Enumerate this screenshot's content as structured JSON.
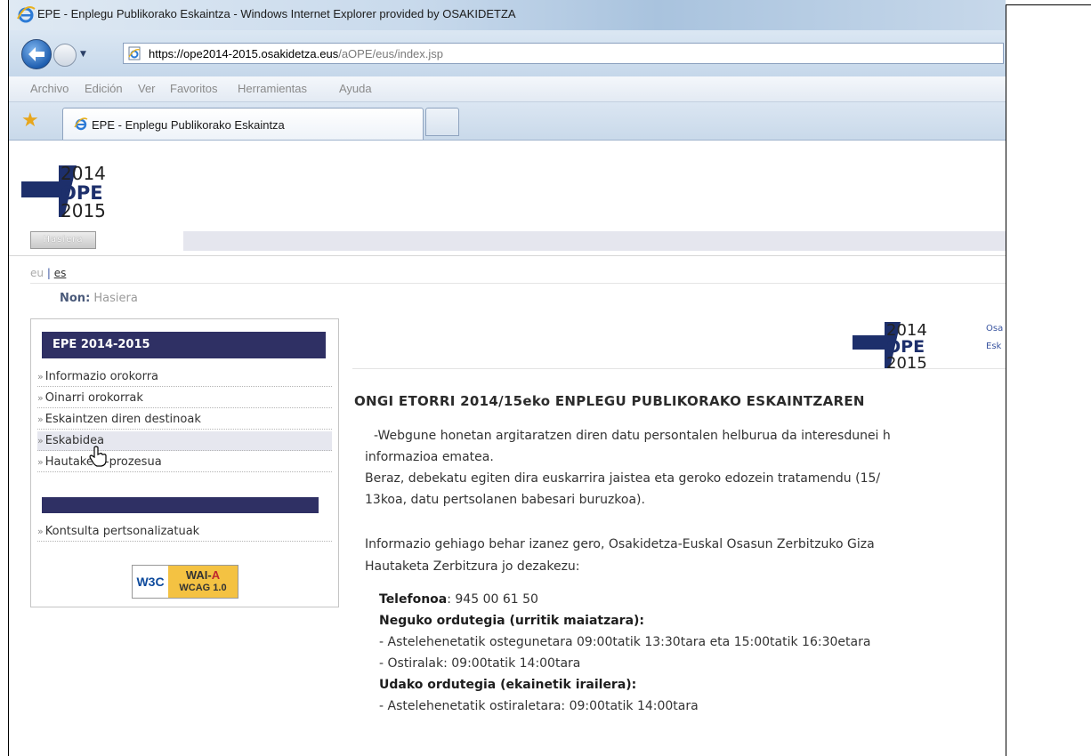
{
  "window": {
    "title": "EPE - Enplegu Publikorako Eskaintza - Windows Internet Explorer provided by OSAKIDETZA"
  },
  "address_bar": {
    "url_host": "https://ope2014-2015.osakidetza.eus",
    "url_path": "/aOPE/eus/index.jsp"
  },
  "menubar": {
    "items": [
      "Archivo",
      "Edición",
      "Ver",
      "Favoritos",
      "Herramientas",
      "Ayuda"
    ]
  },
  "tabs": [
    {
      "label": "EPE - Enplegu Publikorako Eskaintza"
    }
  ],
  "logo": {
    "top": "2014",
    "mid": "OPE",
    "bottom": "2015"
  },
  "nav": {
    "home_label": "Hasiera"
  },
  "lang": {
    "eu": "eu",
    "sep": "|",
    "es": "es"
  },
  "breadcrumb": {
    "label": "Non:",
    "current": "Hasiera"
  },
  "sidebar": {
    "header": "EPE 2014-2015",
    "items": [
      {
        "label": "Informazio orokorra"
      },
      {
        "label": "Oinarri orokorrak"
      },
      {
        "label": "Eskaintzen diren destinoak"
      },
      {
        "label": "Eskabidea"
      },
      {
        "label": "Hautaketa-prozesua"
      }
    ],
    "items2": [
      {
        "label": "Kontsulta pertsonalizatuak"
      }
    ],
    "badge": {
      "w3c": "W3C",
      "wai": "WAI-",
      "wai_level": "A",
      "wcag": "WCAG 1.0"
    }
  },
  "main": {
    "side_text_1": "Osa",
    "side_text_2": "Esk",
    "title": "ONGI ETORRI 2014/15eko ENPLEGU PUBLIKORAKO ESKAINTZAREN",
    "para1_line1": "-Webgune honetan argitaratzen diren datu persontalen helburua da interesdunei h",
    "para1_line2": "informazioa ematea.",
    "para1_line3": "Beraz, debekatu egiten dira euskarrira jaistea eta geroko edozein tratamendu (15/",
    "para1_line4": "13koa, datu pertsolanen babesari buruzkoa).",
    "para2_line1": "Informazio gehiago behar izanez gero, Osakidetza-Euskal Osasun Zerbitzuko Giza",
    "para2_line2": "Hautaketa Zerbitzura jo dezakezu:",
    "phone_label": "Telefonoa",
    "phone_value": ": 945 00 61 50",
    "winter_title": "Neguko ordutegia (urritik maiatzara):",
    "winter_line1": "- Astelehenetatik ostegunetara 09:00tatik 13:30tara eta 15:00tatik 16:30etara",
    "winter_line2": "- Ostiralak: 09:00tatik 14:00tara",
    "summer_title": "Udako ordutegia (ekainetik irailera):",
    "summer_line1": "- Astelehenetatik ostiraletara: 09:00tatik 14:00tara"
  }
}
